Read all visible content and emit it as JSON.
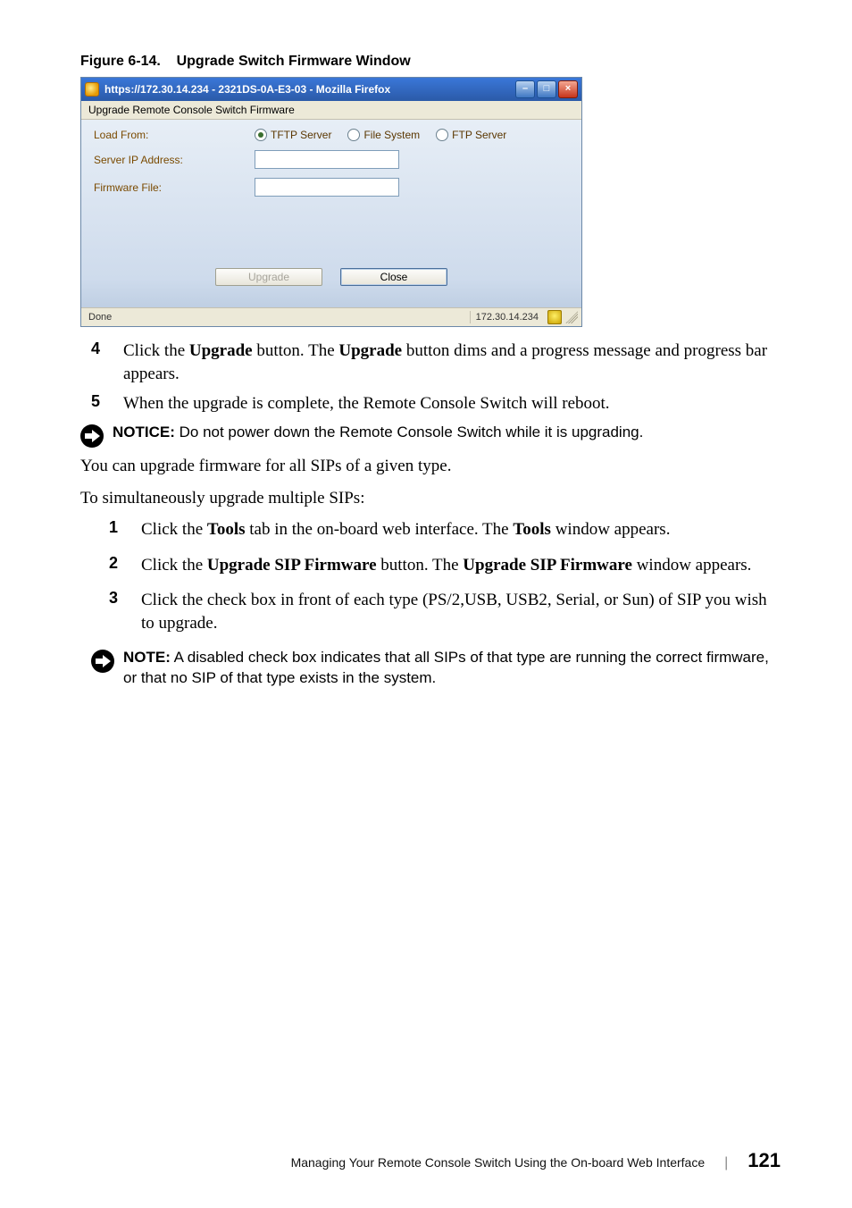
{
  "figure": {
    "label": "Figure 6-14.",
    "title": "Upgrade Switch Firmware Window"
  },
  "window": {
    "title": "https://172.30.14.234 - 2321DS-0A-E3-03 - Mozilla Firefox",
    "minimize": "–",
    "maximize": "□",
    "close": "×",
    "menubar": "Upgrade Remote Console Switch Firmware",
    "form": {
      "load_from_label": "Load From:",
      "radios": {
        "tftp": "TFTP Server",
        "file": "File System",
        "ftp": "FTP Server"
      },
      "server_ip_label": "Server IP Address:",
      "firmware_file_label": "Firmware File:"
    },
    "buttons": {
      "upgrade": "Upgrade",
      "close": "Close"
    },
    "statusbar": {
      "text": "Done",
      "ip": "172.30.14.234"
    }
  },
  "body": {
    "step4_num": "4",
    "step4_a": "Click the ",
    "step4_b": "Upgrade",
    "step4_c": " button. The ",
    "step4_d": "Upgrade",
    "step4_e": " button dims and a progress message and progress bar appears.",
    "step5_num": "5",
    "step5": "When the upgrade is complete, the Remote Console Switch will reboot.",
    "notice_label": "NOTICE:",
    "notice_text": " Do not power down the Remote Console Switch while it is upgrading.",
    "para1": "You can upgrade firmware for all SIPs of a given type.",
    "para2": "To simultaneously upgrade multiple SIPs:",
    "ol1_num": "1",
    "ol1_a": "Click the ",
    "ol1_b": "Tools",
    "ol1_c": " tab in the on-board web interface. The ",
    "ol1_d": "Tools",
    "ol1_e": " window appears.",
    "ol2_num": "2",
    "ol2_a": "Click the ",
    "ol2_b": "Upgrade SIP Firmware",
    "ol2_c": " button. The ",
    "ol2_d": "Upgrade SIP Firmware",
    "ol2_e": " window appears.",
    "ol3_num": "3",
    "ol3": "Click the check box in front of each type (PS/2,USB, USB2, Serial, or Sun) of SIP you wish to upgrade.",
    "note_label": "NOTE:",
    "note_text": " A disabled check box indicates that all SIPs of that type are running the correct firmware, or that no SIP of that type exists in the system."
  },
  "footer": {
    "text": "Managing Your Remote Console Switch Using the On-board Web Interface",
    "sep": "|",
    "page": "121"
  }
}
